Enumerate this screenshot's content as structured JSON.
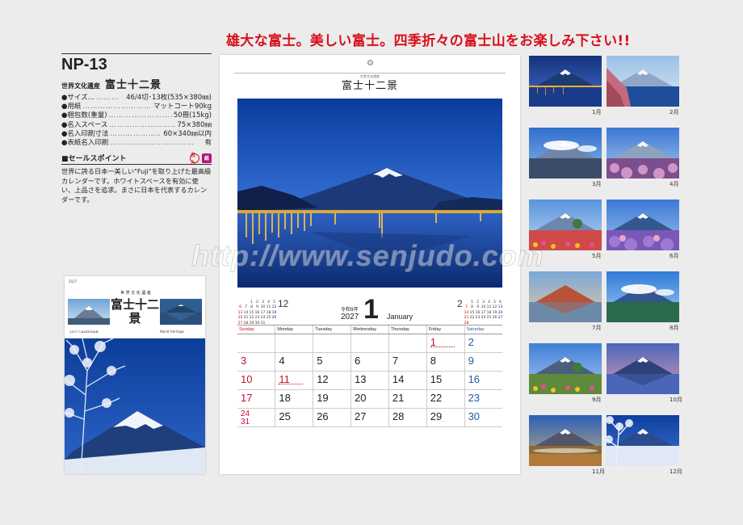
{
  "headline": "雄大な富士。美しい富士。四季折々の富士山をお楽しみ下さい!!",
  "product": {
    "code": "NP-13",
    "subtitle_small": "世界文化遺産",
    "subtitle_large": "富士十二景",
    "specs": [
      {
        "label": "●サイズ…",
        "value": "46/4切･13枚(535×380㎜)"
      },
      {
        "label": "●用紙",
        "value": "マットコート90kg"
      },
      {
        "label": "●梱包数(重量)",
        "value": "50冊(15kg)"
      },
      {
        "label": "●名入スペース",
        "value": "75×380㎜"
      },
      {
        "label": "●名入印刷寸法",
        "value": "60×340㎜以内"
      },
      {
        "label": "●表紙名入印刷",
        "value": "有"
      }
    ],
    "selling_point_title": "■セールスポイント",
    "badge1": "名入",
    "badge2": "紙",
    "selling_point_text": "世界に誇る日本一美しい\"Fuji\"を取り上げた最高級カレンダーです。ホワイトスペースを有効に使い、上品さを追求。まさに日本を代表するカレンダーです。"
  },
  "cover": {
    "top_small": "2027",
    "title_small": "世 界 文 化 遺 産",
    "title": "富士十二景",
    "caption_left": "2027 CALENDAR",
    "caption_right": "World Heritage"
  },
  "calendar": {
    "title_small": "世界文化遺産",
    "title": "富士十二景",
    "era": "令和9年",
    "year": "2027",
    "month_number": "1",
    "month_english": "January",
    "weekdays": [
      "Sunday",
      "Monday",
      "Tuesday",
      "Wednesday",
      "Thursday",
      "Friday",
      "Saturday"
    ],
    "weeks": [
      [
        "",
        "",
        "",
        "",
        "",
        "1",
        "2"
      ],
      [
        "3",
        "4",
        "5",
        "6",
        "7",
        "8",
        "9"
      ],
      [
        "10",
        "11",
        "12",
        "13",
        "14",
        "15",
        "16"
      ],
      [
        "17",
        "18",
        "19",
        "20",
        "21",
        "22",
        "23"
      ],
      [
        "24\n31",
        "25",
        "26",
        "27",
        "28",
        "29",
        "30"
      ]
    ],
    "prev_month": {
      "number": "12",
      "days": [
        "1",
        "2",
        "3",
        "4",
        "5",
        "6",
        "7",
        "8",
        "9",
        "10",
        "11",
        "12",
        "13",
        "14",
        "15",
        "16",
        "17",
        "18",
        "19",
        "20",
        "21",
        "22",
        "23",
        "24",
        "25",
        "26",
        "27",
        "28",
        "29",
        "30",
        "31"
      ]
    },
    "next_month": {
      "number": "2",
      "days": [
        "1",
        "2",
        "3",
        "4",
        "5",
        "6",
        "7",
        "8",
        "9",
        "10",
        "11",
        "12",
        "13",
        "14",
        "15",
        "16",
        "17",
        "18",
        "19",
        "20",
        "21",
        "22",
        "23",
        "24",
        "25",
        "26",
        "27",
        "28"
      ]
    }
  },
  "watermark": "http://www.senjudo.com",
  "thumbnails": [
    "1月",
    "2月",
    "3月",
    "4月",
    "5月",
    "6月",
    "7月",
    "8月",
    "9月",
    "10月",
    "11月",
    "12月"
  ]
}
